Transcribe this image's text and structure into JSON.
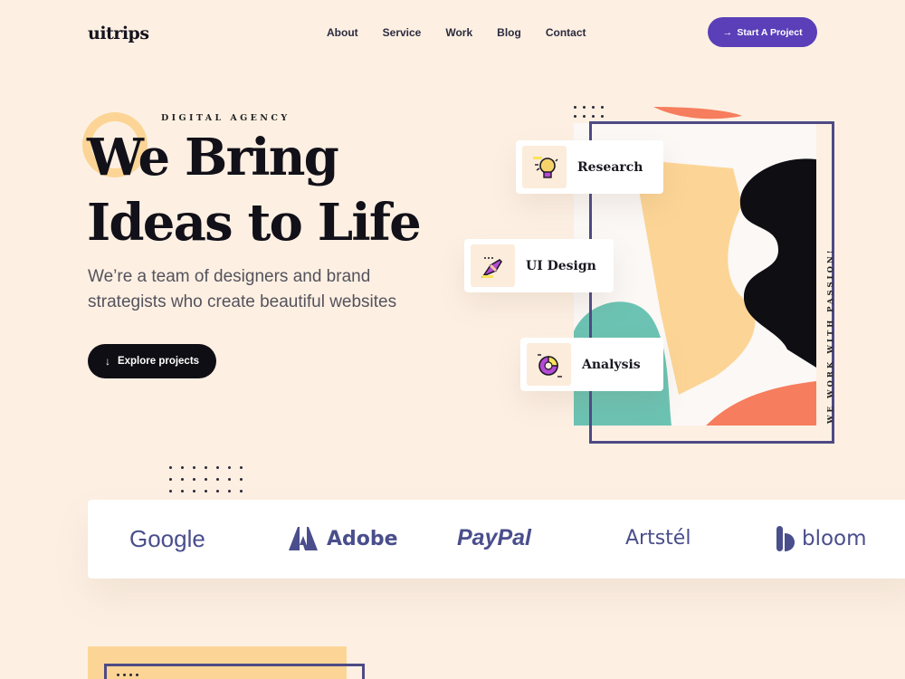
{
  "header": {
    "logo": "uitrips",
    "nav": [
      "About",
      "Service",
      "Work",
      "Blog",
      "Contact"
    ],
    "cta_label": "Start A Project"
  },
  "hero": {
    "eyebrow": "DIGITAL AGENCY",
    "headline_line1": "We Bring",
    "headline_line2": "Ideas to Life",
    "subtitle": "We’re a team of designers and brand strategists who create beautiful websites",
    "explore_label": "Explore projects"
  },
  "cards": {
    "research": "Research",
    "ui_design": "UI Design",
    "analysis": "Analysis"
  },
  "vertical_text": "WE WORK WITH PASSION!",
  "brands": {
    "google": "Google",
    "adobe": "Adobe",
    "paypal": "PayPal",
    "artstel": "Artstél",
    "bloom": "bloom"
  },
  "icons": [
    "arrow-right-icon",
    "arrow-down-icon",
    "lightbulb-icon",
    "pen-tool-icon",
    "pie-chart-icon",
    "adobe-logo-icon",
    "bloom-logo-icon"
  ],
  "colors": {
    "background": "#fdf0e3",
    "accent": "#5a3fb8",
    "frame": "#4e4a85",
    "yellow": "#fcd596",
    "orange": "#f67d5d",
    "teal": "#6cc3b3",
    "brand_logo": "#4a4e8c"
  }
}
